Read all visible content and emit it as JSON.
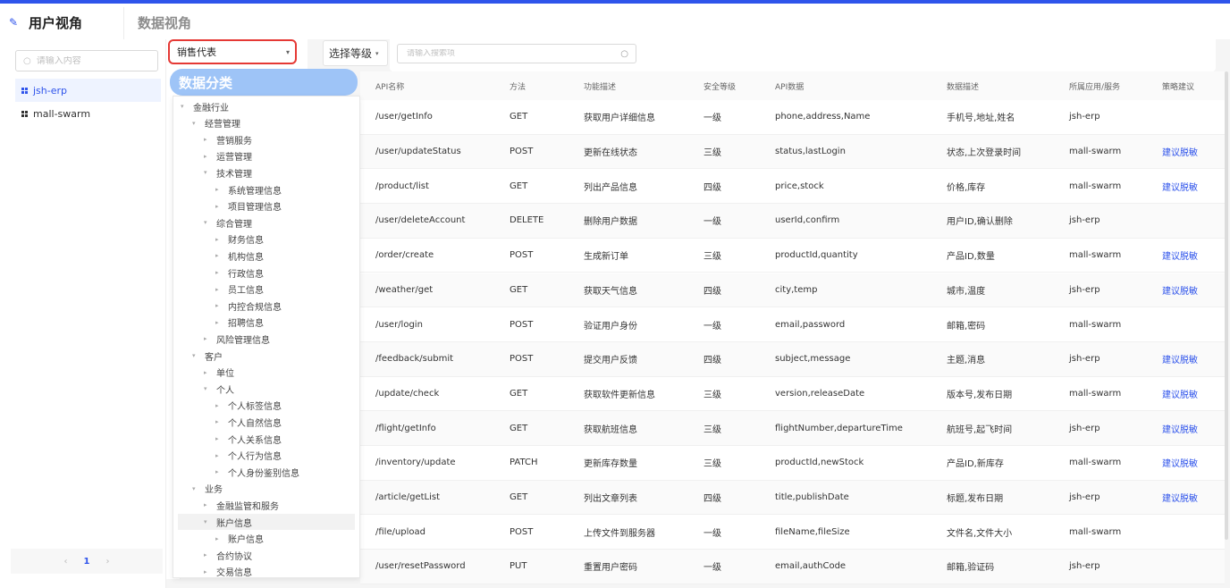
{
  "tabs": {
    "user_view": "用户视角",
    "data_view": "数据视角"
  },
  "sidebar": {
    "search_placeholder": "请输入内容",
    "apps": [
      "jsh-erp",
      "mall-swarm"
    ],
    "pager": {
      "prev": "‹",
      "page": "1",
      "next": "›"
    }
  },
  "filters": {
    "role_value": "销售代表",
    "level_label": "选择等级",
    "api_search_placeholder": "请输入搜索项"
  },
  "tree": {
    "title": "数据分类",
    "nodes": [
      {
        "label": "金融行业",
        "level": 0,
        "expanded": true
      },
      {
        "label": "经营管理",
        "level": 1,
        "expanded": true
      },
      {
        "label": "营销服务",
        "level": 2,
        "expanded": false
      },
      {
        "label": "运营管理",
        "level": 2,
        "expanded": false
      },
      {
        "label": "技术管理",
        "level": 2,
        "expanded": true
      },
      {
        "label": "系统管理信息",
        "level": 3,
        "expanded": false
      },
      {
        "label": "项目管理信息",
        "level": 3,
        "expanded": false
      },
      {
        "label": "综合管理",
        "level": 2,
        "expanded": true
      },
      {
        "label": "财务信息",
        "level": 3,
        "expanded": false
      },
      {
        "label": "机构信息",
        "level": 3,
        "expanded": false
      },
      {
        "label": "行政信息",
        "level": 3,
        "expanded": false
      },
      {
        "label": "员工信息",
        "level": 3,
        "expanded": false
      },
      {
        "label": "内控合规信息",
        "level": 3,
        "expanded": false
      },
      {
        "label": "招聘信息",
        "level": 3,
        "expanded": false
      },
      {
        "label": "风险管理信息",
        "level": 2,
        "expanded": false
      },
      {
        "label": "客户",
        "level": 1,
        "expanded": true
      },
      {
        "label": "单位",
        "level": 2,
        "expanded": false
      },
      {
        "label": "个人",
        "level": 2,
        "expanded": true
      },
      {
        "label": "个人标签信息",
        "level": 3,
        "expanded": false
      },
      {
        "label": "个人自然信息",
        "level": 3,
        "expanded": false
      },
      {
        "label": "个人关系信息",
        "level": 3,
        "expanded": false
      },
      {
        "label": "个人行为信息",
        "level": 3,
        "expanded": false
      },
      {
        "label": "个人身份鉴别信息",
        "level": 3,
        "expanded": false
      },
      {
        "label": "业务",
        "level": 1,
        "expanded": true
      },
      {
        "label": "金融监管和服务",
        "level": 2,
        "expanded": false
      },
      {
        "label": "账户信息",
        "level": 2,
        "expanded": true,
        "selected": true
      },
      {
        "label": "账户信息",
        "level": 3,
        "expanded": false
      },
      {
        "label": "合约协议",
        "level": 2,
        "expanded": false
      },
      {
        "label": "交易信息",
        "level": 2,
        "expanded": false
      }
    ]
  },
  "table": {
    "headers": [
      "API名称",
      "方法",
      "功能描述",
      "安全等级",
      "API数据",
      "数据描述",
      "所属应用/服务",
      "策略建议"
    ],
    "rows": [
      [
        "/user/getInfo",
        "GET",
        "获取用户详细信息",
        "一级",
        "phone,address,Name",
        "手机号,地址,姓名",
        "jsh-erp",
        ""
      ],
      [
        "/user/updateStatus",
        "POST",
        "更新在线状态",
        "三级",
        "status,lastLogin",
        "状态,上次登录时间",
        "mall-swarm",
        "建议脱敏"
      ],
      [
        "/product/list",
        "GET",
        "列出产品信息",
        "四级",
        "price,stock",
        "价格,库存",
        "mall-swarm",
        "建议脱敏"
      ],
      [
        "/user/deleteAccount",
        "DELETE",
        "删除用户数据",
        "一级",
        "userId,confirm",
        "用户ID,确认删除",
        "jsh-erp",
        ""
      ],
      [
        "/order/create",
        "POST",
        "生成新订单",
        "三级",
        "productId,quantity",
        "产品ID,数量",
        "mall-swarm",
        "建议脱敏"
      ],
      [
        "/weather/get",
        "GET",
        "获取天气信息",
        "四级",
        "city,temp",
        "城市,温度",
        "jsh-erp",
        "建议脱敏"
      ],
      [
        "/user/login",
        "POST",
        "验证用户身份",
        "一级",
        "email,password",
        "邮箱,密码",
        "mall-swarm",
        ""
      ],
      [
        "/feedback/submit",
        "POST",
        "提交用户反馈",
        "四级",
        "subject,message",
        "主题,消息",
        "jsh-erp",
        "建议脱敏"
      ],
      [
        "/update/check",
        "GET",
        "获取软件更新信息",
        "三级",
        "version,releaseDate",
        "版本号,发布日期",
        "mall-swarm",
        "建议脱敏"
      ],
      [
        "/flight/getInfo",
        "GET",
        "获取航班信息",
        "三级",
        "flightNumber,departureTime",
        "航班号,起飞时间",
        "jsh-erp",
        "建议脱敏"
      ],
      [
        "/inventory/update",
        "PATCH",
        "更新库存数量",
        "三级",
        "productId,newStock",
        "产品ID,新库存",
        "mall-swarm",
        "建议脱敏"
      ],
      [
        "/article/getList",
        "GET",
        "列出文章列表",
        "四级",
        "title,publishDate",
        "标题,发布日期",
        "jsh-erp",
        "建议脱敏"
      ],
      [
        "/file/upload",
        "POST",
        "上传文件到服务器",
        "一级",
        "fileName,fileSize",
        "文件名,文件大小",
        "mall-swarm",
        ""
      ],
      [
        "/user/resetPassword",
        "PUT",
        "重置用户密码",
        "一级",
        "email,authCode",
        "邮箱,验证码",
        "jsh-erp",
        ""
      ]
    ]
  },
  "colors": {
    "accent": "#2f54eb",
    "highlight_border": "#e53935",
    "tree_header": "#9ec4f7"
  }
}
